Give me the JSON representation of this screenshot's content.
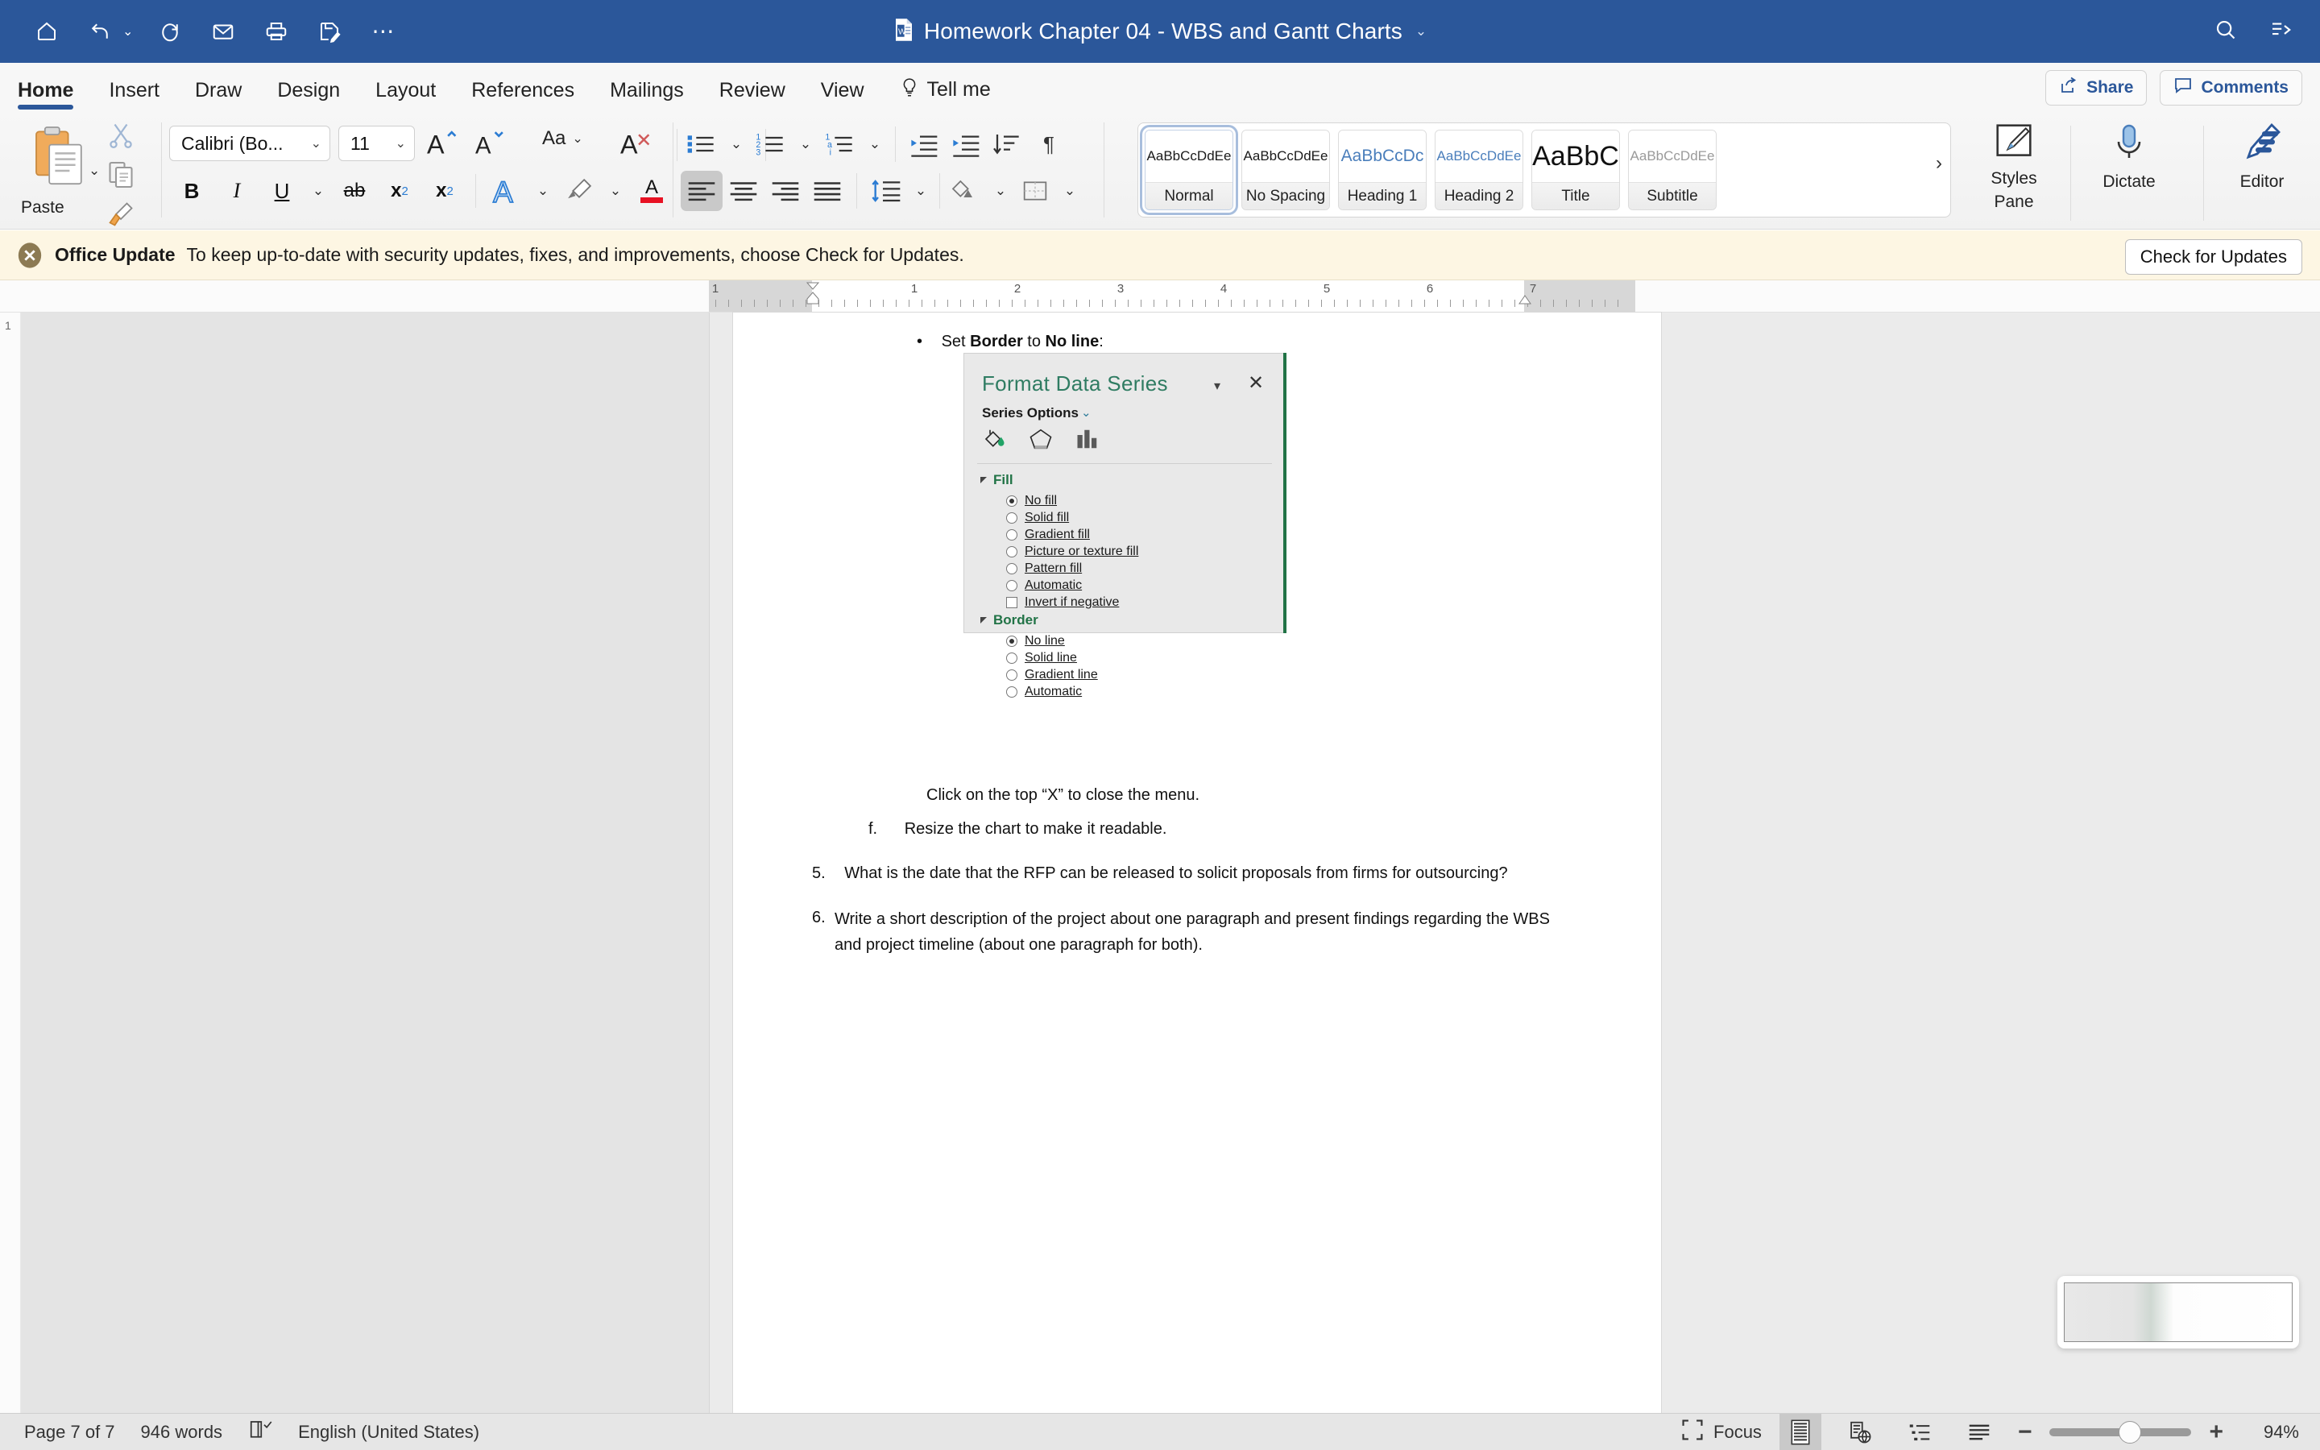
{
  "titlebar": {
    "document_title": "Homework Chapter 04 - WBS and Gantt Charts",
    "title_caret": "⌄",
    "quick_access": [
      {
        "name": "home-icon",
        "label": "Home"
      },
      {
        "name": "undo-icon",
        "label": "Undo"
      },
      {
        "name": "undo-dropdown-caret",
        "label": "⌄"
      },
      {
        "name": "redo-icon",
        "label": "Redo"
      },
      {
        "name": "mail-icon",
        "label": "Email"
      },
      {
        "name": "print-icon",
        "label": "Print"
      },
      {
        "name": "save-icon",
        "label": "Save"
      },
      {
        "name": "more-options-icon",
        "label": "⋯"
      }
    ],
    "right_icons": [
      {
        "name": "search-icon",
        "label": "Search"
      },
      {
        "name": "ribbon-display-icon",
        "label": "Ribbon Display Options"
      }
    ],
    "bg_color": "#2b579a"
  },
  "ribbon": {
    "tabs": [
      {
        "label": "Home",
        "active": true
      },
      {
        "label": "Insert",
        "active": false
      },
      {
        "label": "Draw",
        "active": false
      },
      {
        "label": "Design",
        "active": false
      },
      {
        "label": "Layout",
        "active": false
      },
      {
        "label": "References",
        "active": false
      },
      {
        "label": "Mailings",
        "active": false
      },
      {
        "label": "Review",
        "active": false
      },
      {
        "label": "View",
        "active": false
      }
    ],
    "tell_me": "Tell me",
    "share_label": "Share",
    "comments_label": "Comments",
    "accent_color": "#2b579a",
    "clipboard": {
      "paste_label": "Paste",
      "paste_caret": "⌄",
      "cut_label": "Cut",
      "copy_label": "Copy",
      "format_painter_label": "Format Painter"
    },
    "font": {
      "font_name_value": "Calibri (Bo...",
      "font_size_value": "11",
      "caret": "⌄",
      "grow_label": "A",
      "shrink_label": "A",
      "change_case_label": "Aa",
      "clear_formatting_label": "Clear Formatting",
      "bold": "B",
      "italic": "I",
      "underline": "U",
      "strikethrough": "ab",
      "subscript": "x",
      "subscript_sub": "2",
      "superscript": "x",
      "superscript_sup": "2",
      "text_effects_label": "A",
      "highlight_label": "Text Highlight Color",
      "font_color_label": "A",
      "font_color_swatch": "#e81123"
    },
    "paragraph": {
      "bullets_label": "Bullets",
      "numbering_label": "Numbering",
      "multilevel_label": "Multilevel List",
      "decrease_indent_label": "Decrease Indent",
      "increase_indent_label": "Increase Indent",
      "sort_label": "Sort",
      "show_marks_label": "¶",
      "align_left_label": "Align Left",
      "align_center_label": "Center",
      "align_right_label": "Align Right",
      "justify_label": "Justify",
      "line_spacing_label": "Line Spacing",
      "shading_label": "Shading",
      "borders_label": "Borders"
    },
    "styles": [
      {
        "preview": "AaBbCcDdEe",
        "name": "Normal",
        "selected": true,
        "style_class": ""
      },
      {
        "preview": "AaBbCcDdEe",
        "name": "No Spacing",
        "selected": false,
        "style_class": ""
      },
      {
        "preview": "AaBbCcDc",
        "name": "Heading 1",
        "selected": false,
        "style_class": "sp-h1"
      },
      {
        "preview": "AaBbCcDdEe",
        "name": "Heading 2",
        "selected": false,
        "style_class": "sp-h2"
      },
      {
        "preview": "AaBbC",
        "name": "Title",
        "selected": false,
        "style_class": "sp-title"
      },
      {
        "preview": "AaBbCcDdEe",
        "name": "Subtitle",
        "selected": false,
        "style_class": "sp-sub"
      }
    ],
    "styles_more_caret": "›",
    "styles_pane_label": "Styles\nPane",
    "styles_pane_line1": "Styles",
    "styles_pane_line2": "Pane",
    "dictate_label": "Dictate",
    "editor_label": "Editor"
  },
  "update_bar": {
    "strong": "Office Update",
    "message": "To keep up-to-date with security updates, fixes, and improvements, choose Check for Updates.",
    "button_label": "Check for Updates",
    "bg_color": "#fdf6e3"
  },
  "ruler": {
    "vertical_mark": "1",
    "numbers": [
      "1",
      "1",
      "2",
      "3",
      "4",
      "5",
      "6",
      "7"
    ]
  },
  "document": {
    "items": [
      {
        "id": "set-border",
        "marker": "•",
        "runs": [
          {
            "text": "Set ",
            "bold": false
          },
          {
            "text": "Border",
            "bold": true
          },
          {
            "text": " to ",
            "bold": false
          },
          {
            "text": "No line",
            "bold": true
          },
          {
            "text": ":",
            "bold": false
          }
        ]
      },
      {
        "id": "close-menu-note",
        "marker": "",
        "text": "Click on the top “X” to close the menu."
      },
      {
        "id": "item-f",
        "marker": "f.",
        "text": "Resize the chart to make it readable."
      },
      {
        "id": "item-5",
        "marker": "5.",
        "text": "What is the date that the RFP can be released to solicit proposals from firms for outsourcing?"
      },
      {
        "id": "item-6",
        "marker": "6.",
        "text": "Write a short description of the project about one paragraph and present findings regarding the WBS and project timeline (about one paragraph for both)."
      }
    ],
    "format_data_series": {
      "title": "Format Data Series",
      "title_color": "#2f7c62",
      "collapse_caret": "▾",
      "close_label": "✕",
      "subtitle": "Series Options",
      "subtitle_caret": "⌄",
      "tab_icons": [
        {
          "name": "fill-paint-bucket-icon",
          "label": "Fill & Line"
        },
        {
          "name": "effects-pentagon-icon",
          "label": "Effects"
        },
        {
          "name": "series-options-chart-icon",
          "label": "Series Options"
        }
      ],
      "sections": [
        {
          "header": "Fill",
          "header_color": "#217346",
          "options": [
            {
              "label": "No fill",
              "type": "radio",
              "checked": true,
              "accel": "N"
            },
            {
              "label": "Solid fill",
              "type": "radio",
              "checked": false,
              "accel": "S"
            },
            {
              "label": "Gradient fill",
              "type": "radio",
              "checked": false,
              "accel": "G"
            },
            {
              "label": "Picture or texture fill",
              "type": "radio",
              "checked": false,
              "accel": "P"
            },
            {
              "label": "Pattern fill",
              "type": "radio",
              "checked": false,
              "accel": "a"
            },
            {
              "label": "Automatic",
              "type": "radio",
              "checked": false,
              "accel": "u"
            },
            {
              "label": "Invert if negative",
              "type": "checkbox",
              "checked": false,
              "accel": "I"
            }
          ]
        },
        {
          "header": "Border",
          "header_color": "#217346",
          "options": [
            {
              "label": "No line",
              "type": "radio",
              "checked": true,
              "accel": "N"
            },
            {
              "label": "Solid line",
              "type": "radio",
              "checked": false,
              "accel": "S"
            },
            {
              "label": "Gradient line",
              "type": "radio",
              "checked": false,
              "accel": "G"
            },
            {
              "label": "Automatic",
              "type": "radio",
              "checked": false,
              "accel": "u"
            }
          ]
        }
      ]
    }
  },
  "statusbar": {
    "page_info": "Page 7 of 7",
    "word_count": "946 words",
    "proofing_icon_label": "Proofing errors",
    "language": "English (United States)",
    "focus_label": "Focus",
    "views": [
      {
        "name": "print-layout-view",
        "selected": true
      },
      {
        "name": "web-layout-view",
        "selected": false
      },
      {
        "name": "outline-view",
        "selected": false
      },
      {
        "name": "draft-view",
        "selected": false
      }
    ],
    "zoom_out_label": "−",
    "zoom_in_label": "+",
    "zoom_level": "94%",
    "zoom_percent": 94
  }
}
